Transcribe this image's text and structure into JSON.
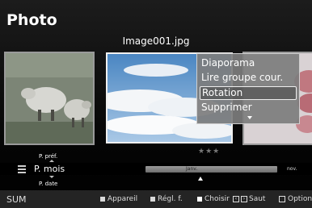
{
  "app": {
    "title": "Photo"
  },
  "viewer": {
    "filename": "Image001.jpg",
    "rating_stars": "★★★"
  },
  "context_menu": {
    "items": [
      {
        "label": "Diaporama"
      },
      {
        "label": "Lire groupe cour."
      },
      {
        "label": "Rotation",
        "selected": true
      },
      {
        "label": "Supprimer"
      }
    ],
    "more_icon": "chevron-down-icon"
  },
  "sort": {
    "previous": "P. préf.",
    "current": "P. mois",
    "next": "P. date"
  },
  "timeline": {
    "current": "Janv.",
    "next": "nov."
  },
  "bottom_bar": {
    "source": "SUM",
    "help": [
      {
        "key_color": "#d8d8d8",
        "label": "Appareil"
      },
      {
        "key_color": "#d8d8d8",
        "label": "Régl. f."
      },
      {
        "key_color": "#ffffff",
        "label": "Choisir"
      },
      {
        "key_icon": "skip-icons",
        "label": "Saut"
      },
      {
        "key_icon": "tools-icon",
        "label": "Options"
      }
    ]
  },
  "colors": {
    "menu_bg": "#7d7d7d",
    "highlight_border": "#efefef"
  }
}
